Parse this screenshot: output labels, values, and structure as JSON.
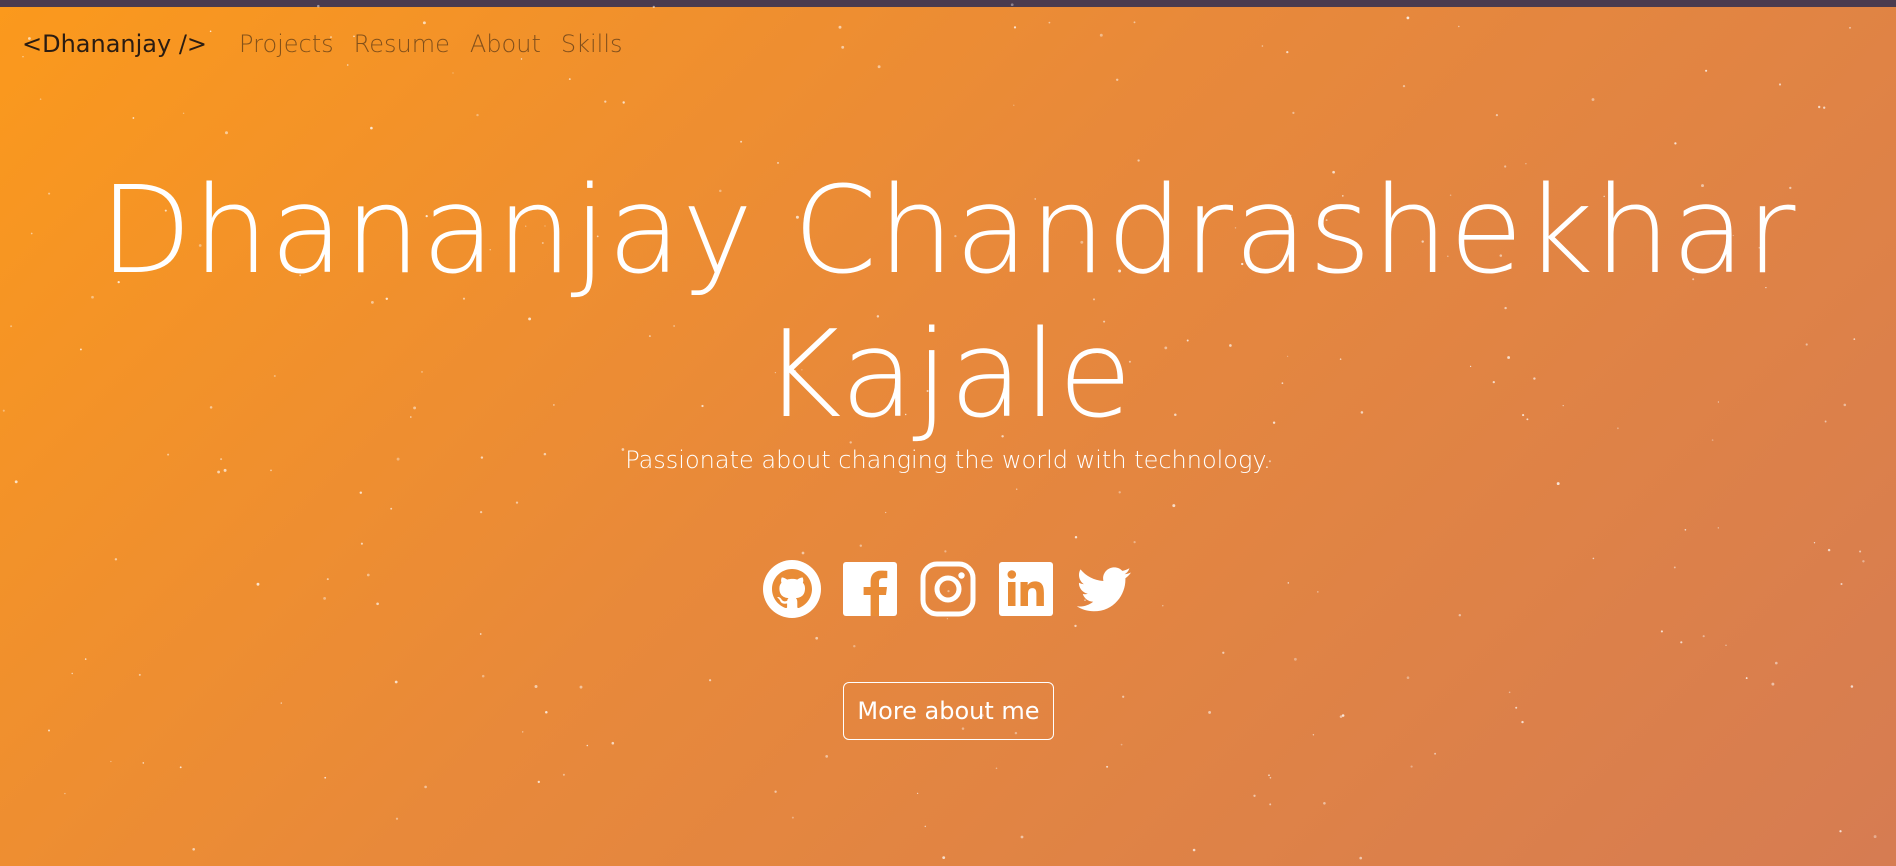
{
  "navbar": {
    "brand": "<Dhananjay />",
    "links": [
      {
        "label": "Projects"
      },
      {
        "label": "Resume"
      },
      {
        "label": "About"
      },
      {
        "label": "Skills"
      }
    ]
  },
  "hero": {
    "name_line1": "Dhananjay Chandrashekhar",
    "name_line2": "Kajale",
    "tagline": "Passionate about changing the world with technology.",
    "cta_label": "More about me"
  },
  "social": [
    {
      "icon": "github-icon"
    },
    {
      "icon": "facebook-icon"
    },
    {
      "icon": "instagram-icon"
    },
    {
      "icon": "linkedin-icon"
    },
    {
      "icon": "twitter-icon"
    }
  ],
  "colors": {
    "gradient_start": "#fb991c",
    "gradient_end": "#d67c52",
    "top_strip": "#4a3b4f",
    "text": "#ffffff",
    "brand_text": "#2a1c12"
  }
}
